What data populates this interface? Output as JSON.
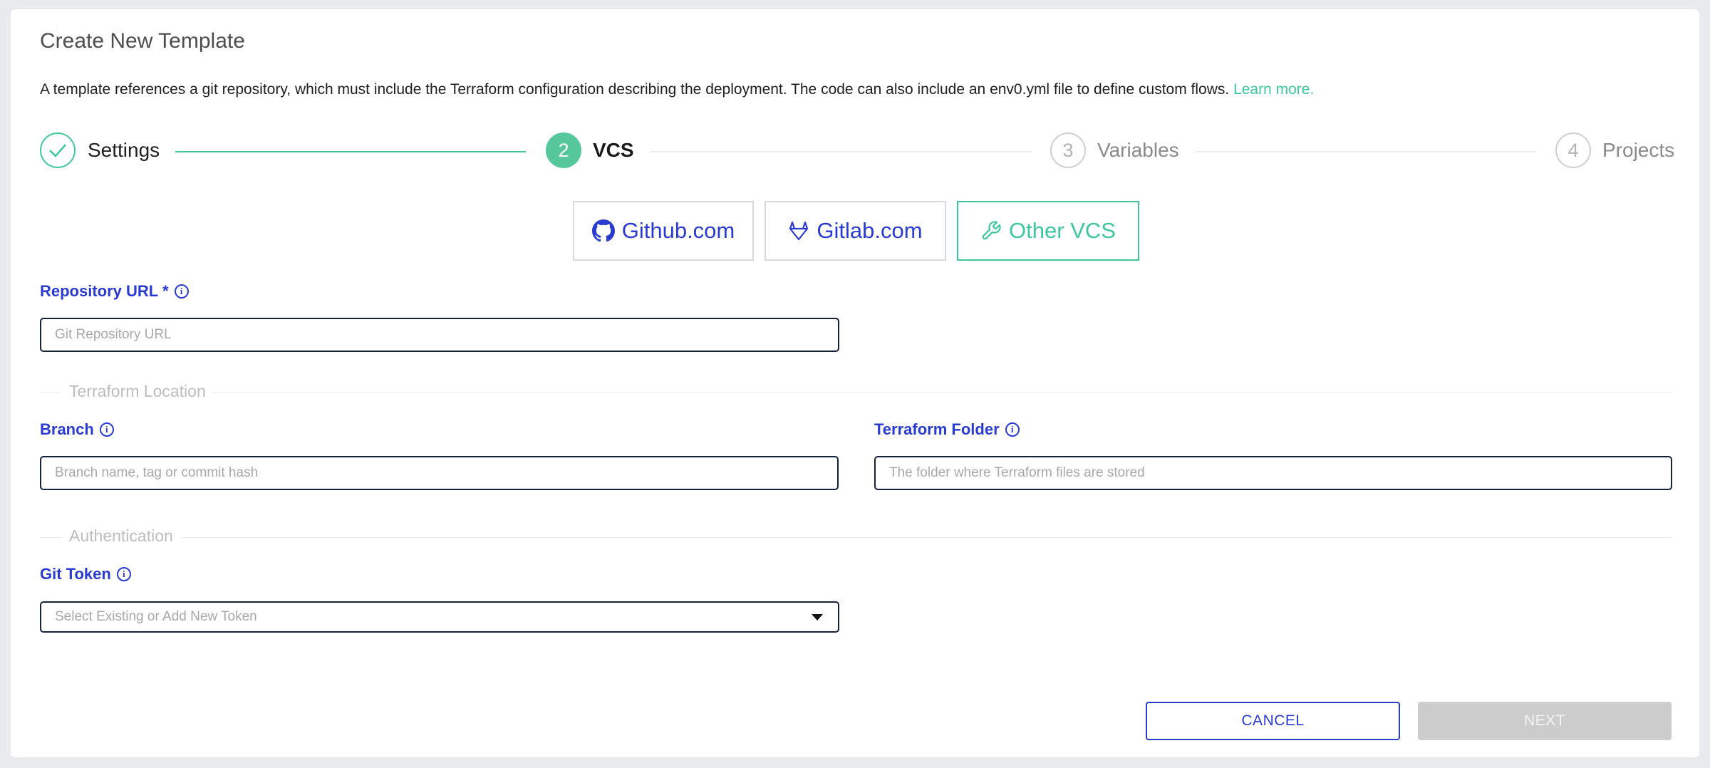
{
  "modal": {
    "title": "Create New Template",
    "description": "A template references a git repository, which must include the Terraform configuration describing the deployment. The code can also include an env0.yml file to define custom flows.",
    "learn_more": "Learn more."
  },
  "stepper": {
    "steps": [
      {
        "number": "1",
        "label": "Settings",
        "state": "completed"
      },
      {
        "number": "2",
        "label": "VCS",
        "state": "active"
      },
      {
        "number": "3",
        "label": "Variables",
        "state": "pending"
      },
      {
        "number": "4",
        "label": "Projects",
        "state": "pending"
      }
    ]
  },
  "vcs_options": [
    {
      "label": "Github.com",
      "icon": "github-icon",
      "selected": false
    },
    {
      "label": "Gitlab.com",
      "icon": "gitlab-icon",
      "selected": false
    },
    {
      "label": "Other VCS",
      "icon": "wrench-icon",
      "selected": true
    }
  ],
  "repository": {
    "label": "Repository URL *",
    "placeholder": "Git Repository URL",
    "value": ""
  },
  "terraform_location": {
    "section_title": "Terraform Location",
    "branch": {
      "label": "Branch",
      "placeholder": "Branch name, tag or commit hash",
      "value": ""
    },
    "folder": {
      "label": "Terraform Folder",
      "placeholder": "The folder where Terraform files are stored",
      "value": ""
    }
  },
  "authentication": {
    "section_title": "Authentication",
    "git_token": {
      "label": "Git Token",
      "placeholder": "Select Existing or Add New Token"
    }
  },
  "footer": {
    "cancel_label": "CANCEL",
    "next_label": "NEXT"
  },
  "colors": {
    "accent_green": "#3ec79b",
    "label_blue": "#2a3bd1",
    "disabled_gray": "#cccccc"
  }
}
